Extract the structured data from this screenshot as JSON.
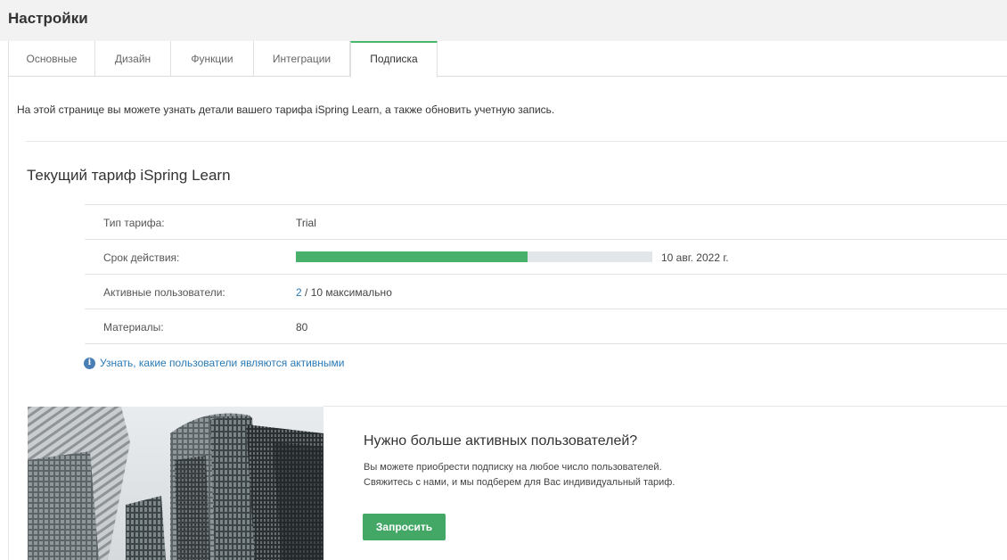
{
  "header": {
    "title": "Настройки"
  },
  "tabs": [
    {
      "label": "Основные"
    },
    {
      "label": "Дизайн"
    },
    {
      "label": "Функции"
    },
    {
      "label": "Интеграции"
    },
    {
      "label": "Подписка"
    }
  ],
  "active_tab": "Подписка",
  "intro_text": "На этой странице вы можете узнать детали вашего тарифа iSpring Learn, а также обновить учетную запись.",
  "plan": {
    "title": "Текущий тариф iSpring Learn",
    "rows": {
      "type": {
        "label": "Тип тарифа:",
        "value": "Trial"
      },
      "validity": {
        "label": "Срок действия:",
        "progress": 0.65,
        "date": "10 авг. 2022 г."
      },
      "active_users": {
        "label": "Активные пользователи:",
        "current": "2",
        "rest": " / 10 максимально"
      },
      "materials": {
        "label": "Материалы:",
        "value": "80"
      }
    },
    "info_link": "Узнать, какие пользователи являются активными"
  },
  "promo": {
    "title": "Нужно больше активных пользователей?",
    "line1": "Вы можете приобрести подписку на любое число пользователей.",
    "line2": "Свяжитесь с нами, и мы подберем для Вас индивидуальный тариф.",
    "button_label": "Запросить"
  },
  "colors": {
    "accent_green": "#48b06a",
    "link_blue": "#2a7ab5",
    "button_green": "#43a766"
  }
}
